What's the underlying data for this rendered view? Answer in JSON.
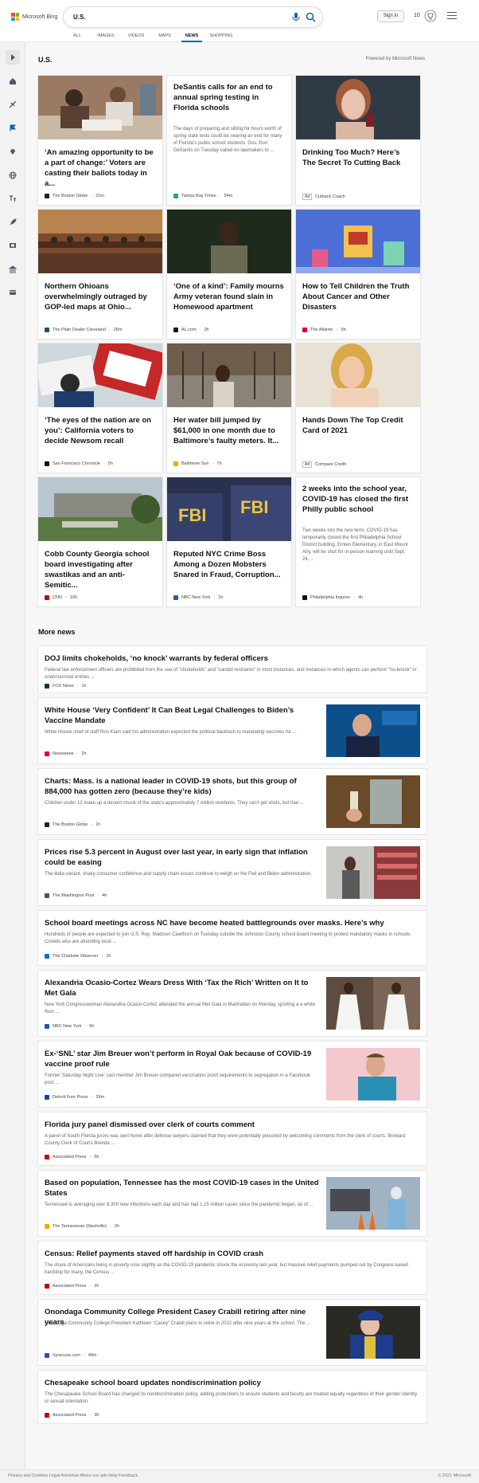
{
  "header": {
    "logo_text": "Microsoft Bing",
    "search_value": "U.S.",
    "signin_label": "Sign in",
    "rewards_count": "10",
    "tabs": [
      "ALL",
      "IMAGES",
      "VIDEOS",
      "MAPS",
      "NEWS",
      "SHOPPING"
    ],
    "active_tab": "NEWS"
  },
  "section": {
    "title": "U.S.",
    "powered_by": "Powered by Microsoft News"
  },
  "cards": [
    {
      "title": "‘An amazing opportunity to be a part of change:’ Voters are casting their ballots today in a...",
      "source": "The Boston Globe",
      "time": "21m"
    },
    {
      "title": "DeSantis calls for an end to annual spring testing in Florida schools",
      "desc": "The days of preparing and sitting for hours worth of spring state tests could be nearing an end for many of Florida’s public school students. Gov. Ron DeSantis on Tuesday called on lawmakers to ...",
      "source": "Tampa Bay Times",
      "time": "54m"
    },
    {
      "title": "Drinking Too Much? Here’s The Secret To Cutting Back",
      "source": "Cutback Coach",
      "ad": "Ad"
    },
    {
      "title": "Northern Ohioans overwhelmingly outraged by GOP-led maps at Ohio...",
      "source": "The Plain Dealer Cleveland",
      "time": "26m"
    },
    {
      "title": "‘One of a kind’: Family mourns Army veteran found slain in Homewood apartment",
      "source": "AL.com",
      "time": "2h"
    },
    {
      "title": "How to Tell Children the Truth About Cancer and Other Disasters",
      "source": "The Atlantic",
      "time": "5h"
    },
    {
      "title": "‘The eyes of the nation are on you’: California voters to decide Newsom recall",
      "source": "San Francisco Chronicle",
      "time": "5h"
    },
    {
      "title": "Her water bill jumped by $61,000 in one month due to Baltimore’s faulty meters. It...",
      "source": "Baltimore Sun",
      "time": "7h"
    },
    {
      "title": "Hands Down The Top Credit Card of 2021",
      "source": "Compare Credit",
      "ad": "Ad"
    },
    {
      "title": "Cobb County Georgia school board investigating after swastikas and an anti-Semitic...",
      "source": "CNN",
      "time": "10h"
    },
    {
      "title": "Reputed NYC Crime Boss Among a Dozen Mobsters Snared in Fraud, Corruption...",
      "source": "NBC New York",
      "time": "1h"
    },
    {
      "title": "2 weeks into the school year, COVID-19 has closed the first Philly public school",
      "desc": "Two weeks into the new term, COVID-19 has temporarily closed the first Philadelphia School District building. Emlen Elementary, in East Mount Airy, will be shut for in-person learning until Sept. 24,...",
      "source": "Philadelphia Inquirer",
      "time": "4h"
    }
  ],
  "more_news": {
    "title": "More news",
    "items": [
      {
        "title": "DOJ limits chokeholds, ‘no knock’ warrants by federal officers",
        "snippet": "Federal law enforcement officers are prohibited from the use of \"chokeholds\" and \"carotid restraints\" in most instances, and instances in which agents can perform \"no-knock\" or unannounced entries ...",
        "source": "FOX News",
        "time": "1h"
      },
      {
        "title": "White House ‘Very Confident’ It Can Beat Legal Challenges to Biden’s Vaccine Mandate",
        "snippet": "White House chief of staff Ron Klain said his administration expected the political backlash to mandating vaccines for ...",
        "source": "Newsweek",
        "time": "2h"
      },
      {
        "title": "Charts: Mass. is a national leader in COVID-19 shots, but this group of 884,000 has gotten zero (because they’re kids)",
        "snippet": "Children under 12 make up a decent chunk of the state's approximately 7 million residents. They can't get shots, but that ...",
        "source": "The Boston Globe",
        "time": "1h"
      },
      {
        "title": "Prices rise 5.3 percent in August over last year, in early sign that inflation could be easing",
        "snippet": "The delta variant, shaky consumer confidence and supply chain issues continue to weigh on the Fed and Biden administration.",
        "source": "The Washington Post",
        "time": "4h"
      },
      {
        "title": "School board meetings across NC have become heated battlegrounds over masks. Here’s why",
        "snippet": "Hundreds of people are expected to join U.S. Rep. Madison Cawthorn on Tuesday outside the Johnston County school board meeting to protest mandatory masks in schools. Crowds also are attending local ...",
        "source": "The Charlotte Observer",
        "time": "1h"
      },
      {
        "title": "Alexandria Ocasio-Cortez Wears Dress With ‘Tax the Rich’ Written on It to Met Gala",
        "snippet": "New York Congresswoman Alexandria Ocasio-Cortez attended the annual Met Gala in Manhattan on Monday, sporting a a white floor ...",
        "source": "NBC New York",
        "time": "5h"
      },
      {
        "title": "Ex-‘SNL’ star Jim Breuer won’t perform in Royal Oak because of COVID-19 vaccine proof rule",
        "snippet": "Former 'Saturday Night Live' cast member Jim Breuer compared vaccination proof requirements to segregation in a Facebook post ...",
        "source": "Detroit Free Press",
        "time": "39m"
      },
      {
        "title": "Florida jury panel dismissed over clerk of courts comment",
        "snippet": "A panel of South Florida jurors was sent home after defense lawyers claimed that they were potentially poisoned by welcoming comments from the clerk of courts. Broward County Clerk of Courts Brenda ...",
        "source": "Associated Press",
        "time": "5h"
      },
      {
        "title": "Based on population, Tennessee has the most COVID-19 cases in the United States",
        "snippet": "Tennessee is averaging over 8,300 new infections each day and has had 1.15 million cases since the pandemic began, as of ...",
        "source": "The Tennessean (Nashville)",
        "time": "2h"
      },
      {
        "title": "Census: Relief payments staved off hardship in COVID crash",
        "snippet": "The share of Americans living in poverty rose slightly as the COVID-19 pandemic shook the economy last year, but massive relief payments pumped out by Congress eased hardship for many, the Census ...",
        "source": "Associated Press",
        "time": "2h"
      },
      {
        "title": "Onondaga Community College President Casey Crabill retiring after nine years",
        "snippet": "Onondaga Community College President Kathleen “Casey” Crabill plans to retire in 2022 after nine years at the school. The ...",
        "source": "Syracuse.com",
        "time": "48m"
      },
      {
        "title": "Chesapeake school board updates nondiscrimination policy",
        "snippet": "The Chesapeake School Board has changed its nondiscrimination policy, adding protections to ensure students and faculty are treated equally regardless of their gender identity or sexual orientation.",
        "source": "Associated Press",
        "time": "3h"
      }
    ]
  },
  "footer": {
    "left": "Privacy and Cookies   Legal   Advertise   About our ads   Help   Feedback",
    "right": "© 2021 Microsoft"
  },
  "colors": {
    "accent": "#0067b8",
    "background": "#f7f7f7",
    "card": "#ffffff"
  }
}
